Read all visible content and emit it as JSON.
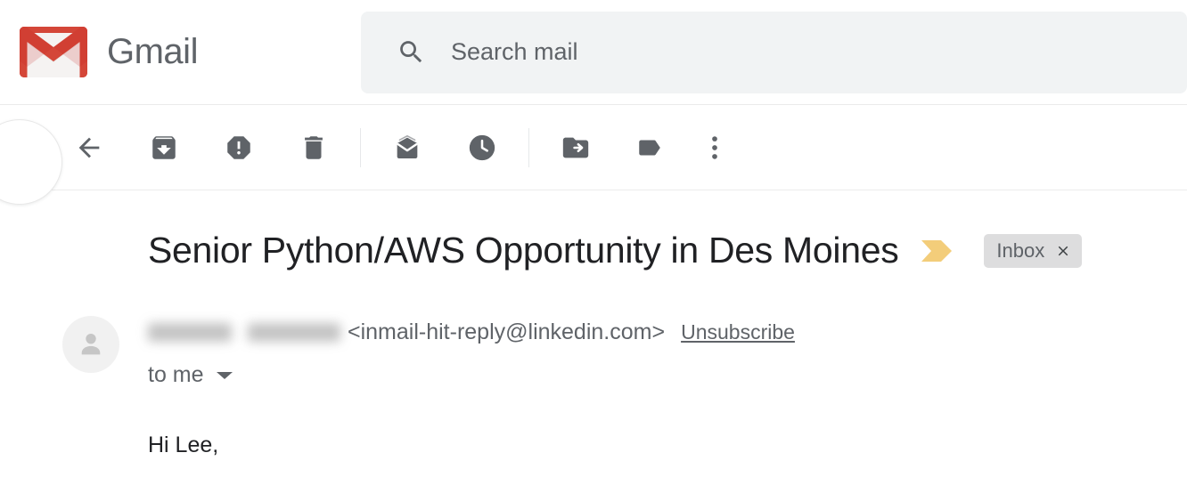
{
  "header": {
    "brand_name": "Gmail",
    "logo_icon": "gmail-envelope-logo",
    "search": {
      "icon": "search-icon",
      "placeholder": "Search mail",
      "value": ""
    }
  },
  "toolbar": {
    "compose_button": "compose-button-partial",
    "buttons": [
      {
        "name": "back-to-inbox-button",
        "icon": "arrow-left-icon",
        "label": "Back to Inbox"
      },
      {
        "name": "archive-button",
        "icon": "archive-icon",
        "label": "Archive"
      },
      {
        "name": "report-spam-button",
        "icon": "report-spam-icon",
        "label": "Report spam"
      },
      {
        "name": "delete-button",
        "icon": "trash-icon",
        "label": "Delete"
      },
      {
        "name": "mark-unread-button",
        "icon": "mark-unread-envelope-icon",
        "label": "Mark as unread"
      },
      {
        "name": "snooze-button",
        "icon": "clock-icon",
        "label": "Snooze"
      },
      {
        "name": "move-to-button",
        "icon": "folder-move-icon",
        "label": "Move to"
      },
      {
        "name": "labels-button",
        "icon": "label-tag-icon",
        "label": "Labels"
      },
      {
        "name": "more-options-button",
        "icon": "more-vertical-dots-icon",
        "label": "More"
      }
    ]
  },
  "message": {
    "subject": "Senior Python/AWS Opportunity in Des Moines",
    "importance_marker": "importance-chevron-icon",
    "label": {
      "text": "Inbox",
      "close_icon": "close-x-icon"
    },
    "sender": {
      "avatar_icon": "person-avatar-icon",
      "name_redacted": true,
      "email": "<inmail-hit-reply@linkedin.com>",
      "unsubscribe_label": "Unsubscribe"
    },
    "recipient": "to me",
    "recipient_caret_icon": "chevron-down-icon",
    "body": "Hi Lee,"
  },
  "colors": {
    "gmail_red": "#d44638",
    "gmail_red_dark": "#c5221f",
    "brand_text": "#5f6368",
    "search_bg": "#f1f3f4",
    "icon_gray": "#5f6368",
    "subject_text": "#202124",
    "label_chip_bg": "#ddddde",
    "importance_yellow": "#f3cd7a",
    "avatar_bg": "#f1f1f1"
  }
}
